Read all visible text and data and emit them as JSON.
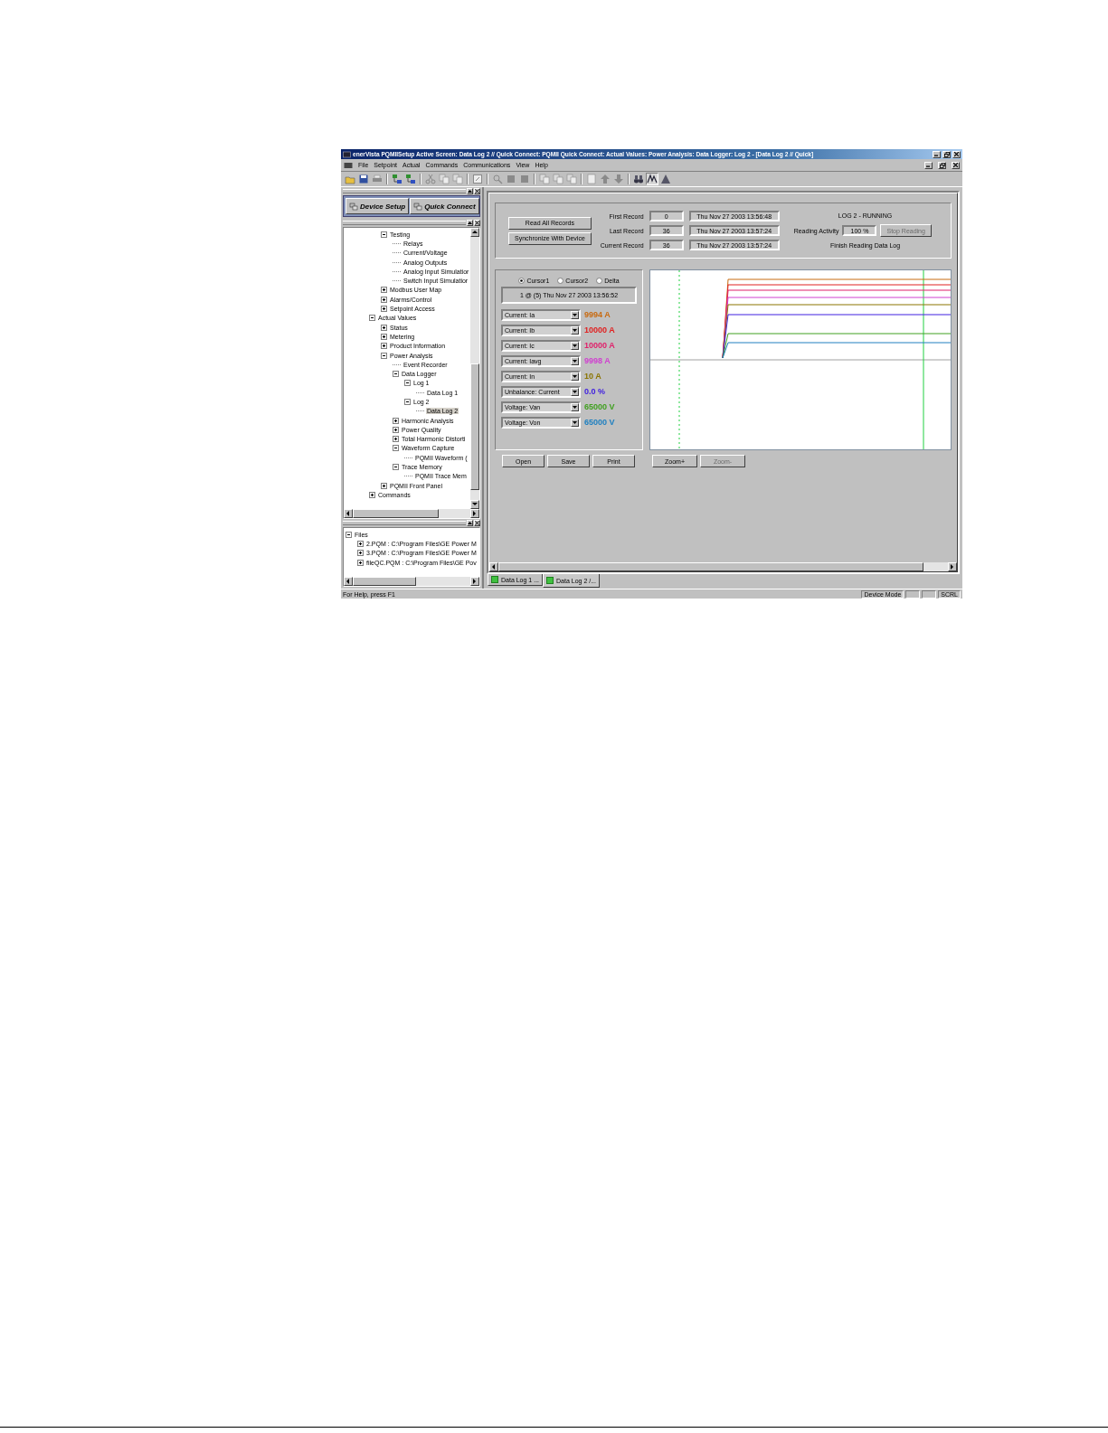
{
  "window": {
    "title": "enerVista PQMIISetup Active Screen: Data Log 2 // Quick Connect: PQMII Quick Connect: Actual Values: Power Analysis: Data Logger: Log 2 - [Data Log 2 // Quick]"
  },
  "menu": [
    "File",
    "Setpoint",
    "Actual",
    "Commands",
    "Communications",
    "View",
    "Help"
  ],
  "left_pane": {
    "quick_buttons": [
      "Device Setup",
      "Quick Connect"
    ],
    "tree": [
      {
        "children": [
          {
            "label": "Testing",
            "expanded": true,
            "selected": false,
            "children": [
              {
                "label": "Relays",
                "selected": false
              },
              {
                "label": "Current/Voltage",
                "selected": false
              },
              {
                "label": "Analog Outputs",
                "selected": false
              },
              {
                "label": "Analog Input Simulatior",
                "selected": false
              },
              {
                "label": "Switch Input Simulatior",
                "selected": false
              }
            ]
          },
          {
            "label": "Modbus User Map",
            "expanded": false,
            "selected": false
          },
          {
            "label": "Alarms/Control",
            "expanded": false,
            "selected": false
          },
          {
            "label": "Setpoint Access",
            "expanded": false,
            "selected": false
          }
        ]
      },
      {
        "label": "Actual Values",
        "expanded": true,
        "selected": false,
        "children": [
          {
            "label": "Status",
            "expanded": false,
            "selected": false
          },
          {
            "label": "Metering",
            "expanded": false,
            "selected": false
          },
          {
            "label": "Product Information",
            "expanded": false,
            "selected": false
          },
          {
            "label": "Power Analysis",
            "expanded": true,
            "selected": false,
            "children": [
              {
                "label": "Event Recorder",
                "selected": false
              },
              {
                "label": "Data Logger",
                "expanded": true,
                "selected": false,
                "children": [
                  {
                    "label": "Log 1",
                    "expanded": true,
                    "selected": false,
                    "children": [
                      {
                        "label": "Data Log 1",
                        "selected": false
                      }
                    ]
                  },
                  {
                    "label": "Log 2",
                    "expanded": true,
                    "selected": false,
                    "children": [
                      {
                        "label": "Data Log 2",
                        "selected": true
                      }
                    ]
                  }
                ]
              },
              {
                "label": "Harmonic Analysis",
                "expanded": false,
                "selected": false
              },
              {
                "label": "Power Quality",
                "expanded": false,
                "selected": false
              },
              {
                "label": "Total Harmonic Distorti",
                "expanded": false,
                "selected": false
              },
              {
                "label": "Waveform Capture",
                "expanded": true,
                "selected": false,
                "children": [
                  {
                    "label": "PQMII Waveform (",
                    "selected": false
                  }
                ]
              },
              {
                "label": "Trace Memory",
                "expanded": true,
                "selected": false,
                "children": [
                  {
                    "label": "PQMII Trace Mem",
                    "selected": false
                  }
                ]
              }
            ]
          },
          {
            "label": "PQMII Front Panel",
            "expanded": false,
            "selected": false
          }
        ]
      },
      {
        "label": "Commands",
        "expanded": false,
        "selected": false
      }
    ],
    "files": [
      {
        "label": "Files",
        "expanded": true,
        "selected": false,
        "children": [
          {
            "label": "2.PQM : C:\\Program Files\\GE Power M",
            "expanded": false,
            "selected": false
          },
          {
            "label": "3.PQM : C:\\Program Files\\GE Power M",
            "expanded": false,
            "selected": false
          },
          {
            "label": "fileQC.PQM : C:\\Program Files\\GE Pov",
            "expanded": false,
            "selected": false
          }
        ]
      }
    ]
  },
  "read_buttons": [
    {
      "label": "Read All Records",
      "disabled": false
    },
    {
      "label": "Synchronize With Device",
      "disabled": false
    }
  ],
  "records": [
    {
      "label": "First Record",
      "number": "0",
      "time": "Thu Nov 27 2003 13:56:48"
    },
    {
      "label": "Last Record",
      "number": "36",
      "time": "Thu Nov 27 2003 13:57:24"
    },
    {
      "label": "Current Record",
      "number": "36",
      "time": "Thu Nov 27 2003 13:57:24"
    }
  ],
  "log_status": {
    "state": "LOG 2 - RUNNING",
    "activity_label": "Reading Activity",
    "activity_value": "100 %",
    "stop_button": {
      "label": "Stop Reading",
      "disabled": true
    },
    "message": "Finish Reading Data Log"
  },
  "cursor_options": [
    {
      "label": "Cursor1",
      "selected": true
    },
    {
      "label": "Cursor2",
      "selected": false
    },
    {
      "label": "Delta",
      "selected": false
    }
  ],
  "cursor_readout": "1 @ (5) Thu Nov 27 2003 13:56:52",
  "channels": [
    {
      "name": "Current: Ia",
      "value": "9994 A",
      "color": "#c86a10"
    },
    {
      "name": "Current: Ib",
      "value": "10000 A",
      "color": "#e02020"
    },
    {
      "name": "Current: Ic",
      "value": "10000 A",
      "color": "#e0206a"
    },
    {
      "name": "Current: Iavg",
      "value": "9998 A",
      "color": "#d040d0"
    },
    {
      "name": "Current: In",
      "value": "10 A",
      "color": "#8a7400"
    },
    {
      "name": "Unbalance: Current",
      "value": "0.0 %",
      "color": "#4020e0"
    },
    {
      "name": "Voltage: Van",
      "value": "65000 V",
      "color": "#40a020"
    },
    {
      "name": "Voltage: Von",
      "value": "65000 V",
      "color": "#2080c0"
    }
  ],
  "file_buttons": [
    {
      "label": "Open",
      "disabled": false
    },
    {
      "label": "Save",
      "disabled": false
    },
    {
      "label": "Print",
      "disabled": false
    }
  ],
  "zoom_buttons": [
    {
      "label": "Zoom+",
      "disabled": false
    },
    {
      "label": "Zoom-",
      "disabled": true
    }
  ],
  "document_tabs": [
    {
      "label": "Data Log 1 ...",
      "selected": false
    },
    {
      "label": "Data Log 2 /...",
      "selected": true
    }
  ],
  "status_bar": {
    "help": "For Help, press F1",
    "panes": [
      "Device Mode",
      "SCRL"
    ]
  }
}
